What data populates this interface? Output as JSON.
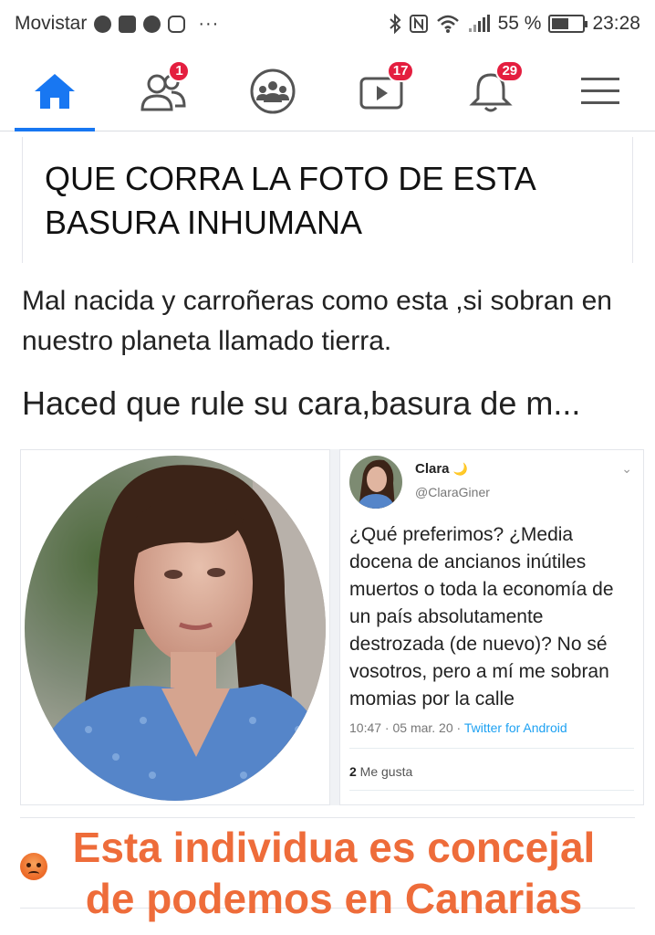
{
  "status_bar": {
    "carrier": "Movistar",
    "dots": "···",
    "battery": "55 %",
    "time": "23:28",
    "icons": [
      "chrome-icon",
      "mail-icon",
      "facebook-icon",
      "instagram-icon",
      "bluetooth-icon",
      "nfc-icon",
      "wifi-icon",
      "signal-icon",
      "battery-icon"
    ]
  },
  "nav": {
    "items": [
      {
        "name": "home",
        "icon": "home-icon",
        "badge": ""
      },
      {
        "name": "friends",
        "icon": "friends-icon",
        "badge": "1"
      },
      {
        "name": "groups",
        "icon": "groups-icon",
        "badge": ""
      },
      {
        "name": "watch",
        "icon": "video-icon",
        "badge": "17"
      },
      {
        "name": "notifications",
        "icon": "bell-icon",
        "badge": "29"
      },
      {
        "name": "menu",
        "icon": "hamburger-icon",
        "badge": ""
      }
    ],
    "accent": "#1877f2",
    "badge_color": "#e41e3f"
  },
  "post": {
    "headline": "QUE CORRA LA FOTO DE ESTA BASURA INHUMANA",
    "text1": "Mal nacida y carroñeras como esta ,si sobran en nuestro planeta llamado tierra.",
    "text2": "Haced que rule su cara,basura de m..."
  },
  "tweet": {
    "name": "Clara",
    "name_emoji": "🌙",
    "handle": "@ClaraGiner",
    "body": "¿Qué preferimos? ¿Media docena de ancianos inútiles muertos o toda la economía de un país absolutamente destrozada (de nuevo)? No sé vosotros, pero a mí me sobran momias por la calle",
    "time": "10:47 · 05 mar. 20 · ",
    "source": "Twitter for Android",
    "likes_count": "2",
    "likes_label": " Me gusta"
  },
  "caption": {
    "line1": "Esta individua es concejal",
    "line2": "de podemos en Canarias",
    "color": "#ee6c3a"
  }
}
